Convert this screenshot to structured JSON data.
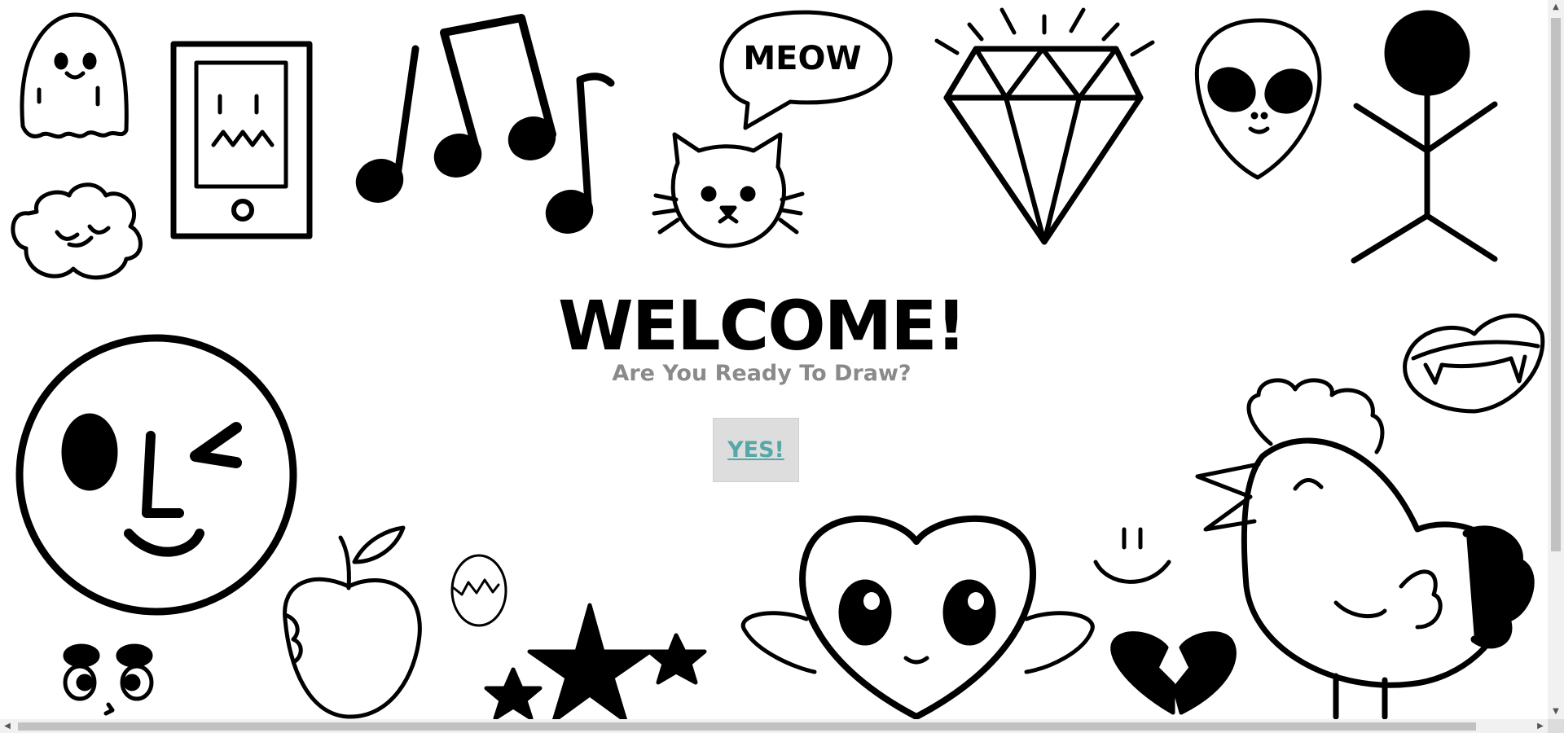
{
  "hero": {
    "title": "WELCOME!",
    "subtitle": "Are You Ready To Draw?",
    "button_label": "YES!"
  },
  "doodles": {
    "speech_bubble_text": "MEOW"
  },
  "colors": {
    "background": "#ffffff",
    "title": "#000000",
    "subtitle": "#8a8a8a",
    "button_bg": "#dddddd",
    "button_text": "#55a7a8"
  },
  "icons": [
    "ghost-icon",
    "phone-icon",
    "music-notes-icon",
    "cat-icon",
    "meow-bubble-icon",
    "diamond-icon",
    "alien-icon",
    "stick-figure-icon",
    "cloud-icon",
    "winking-face-icon",
    "vampire-lips-icon",
    "chicken-icon",
    "apple-icon",
    "egg-icon",
    "stars-icon",
    "heart-character-icon",
    "smile-icon",
    "broken-heart-icon",
    "eyes-icon"
  ]
}
